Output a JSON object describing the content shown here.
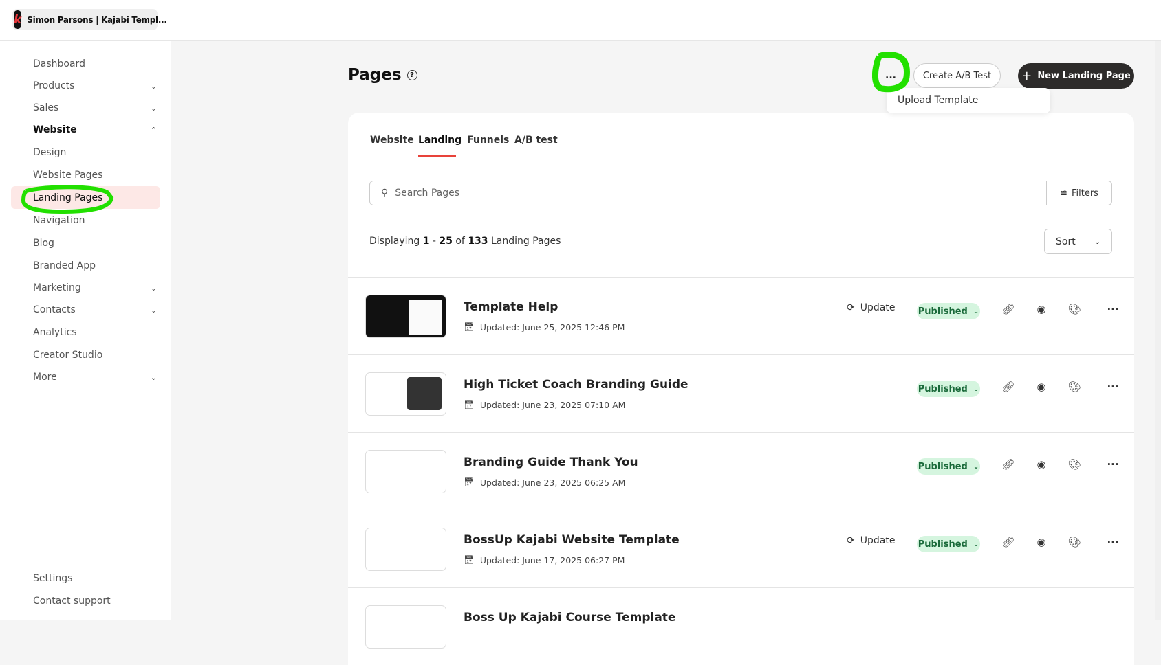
{
  "workspace": {
    "name": "Simon Parsons | Kajabi Templ...",
    "logo_letter": "k"
  },
  "sidebar": {
    "items": [
      {
        "label": "Dashboard",
        "chevron": ""
      },
      {
        "label": "Products",
        "chevron": "down"
      },
      {
        "label": "Sales",
        "chevron": "down"
      },
      {
        "label": "Website",
        "chevron": "up",
        "bold": true
      },
      {
        "label": "Design",
        "chevron": ""
      },
      {
        "label": "Website Pages",
        "chevron": ""
      },
      {
        "label": "Landing Pages",
        "chevron": "",
        "active": true
      },
      {
        "label": "Navigation",
        "chevron": ""
      },
      {
        "label": "Blog",
        "chevron": ""
      },
      {
        "label": "Branded App",
        "chevron": ""
      },
      {
        "label": "Marketing",
        "chevron": "down"
      },
      {
        "label": "Contacts",
        "chevron": "down"
      },
      {
        "label": "Analytics",
        "chevron": ""
      },
      {
        "label": "Creator Studio",
        "chevron": ""
      },
      {
        "label": "More",
        "chevron": "down"
      }
    ],
    "settings": "Settings",
    "support": "Contact support"
  },
  "header": {
    "title": "Pages",
    "more": "...",
    "ab_test": "Create A/B Test",
    "new_page": "New Landing Page",
    "menu_item": "Upload Template"
  },
  "tabs": [
    "Website",
    "Landing",
    "Funnels",
    "A/B test"
  ],
  "search": {
    "placeholder": "Search Pages",
    "filters": "Filters"
  },
  "display": {
    "prefix": "Displaying",
    "start": "1",
    "end": "25",
    "of": "of",
    "total": "133",
    "suffix": "Landing Pages"
  },
  "sort": "Sort",
  "rows": [
    {
      "title": "Template Help",
      "date": "Updated: June 25, 2025 12:46 PM",
      "update": "Update",
      "status": "Published",
      "thumb": "dark"
    },
    {
      "title": "High Ticket Coach Branding Guide",
      "date": "Updated: June 23, 2025 07:10 AM",
      "update": "",
      "status": "Published",
      "thumb": "light"
    },
    {
      "title": "Branding Guide Thank You",
      "date": "Updated: June 23, 2025 06:25 AM",
      "update": "",
      "status": "Published",
      "thumb": "blank"
    },
    {
      "title": "BossUp Kajabi Website Template",
      "date": "Updated: June 17, 2025 06:27 PM",
      "update": "Update",
      "status": "Published",
      "thumb": "blank"
    },
    {
      "title": "Boss Up Kajabi Course Template",
      "date": "",
      "update": "",
      "status": "",
      "thumb": "blank"
    }
  ],
  "colors": {
    "accent": "#e8433a",
    "published_bg": "#d5f5df",
    "annotation": "#22e000"
  }
}
